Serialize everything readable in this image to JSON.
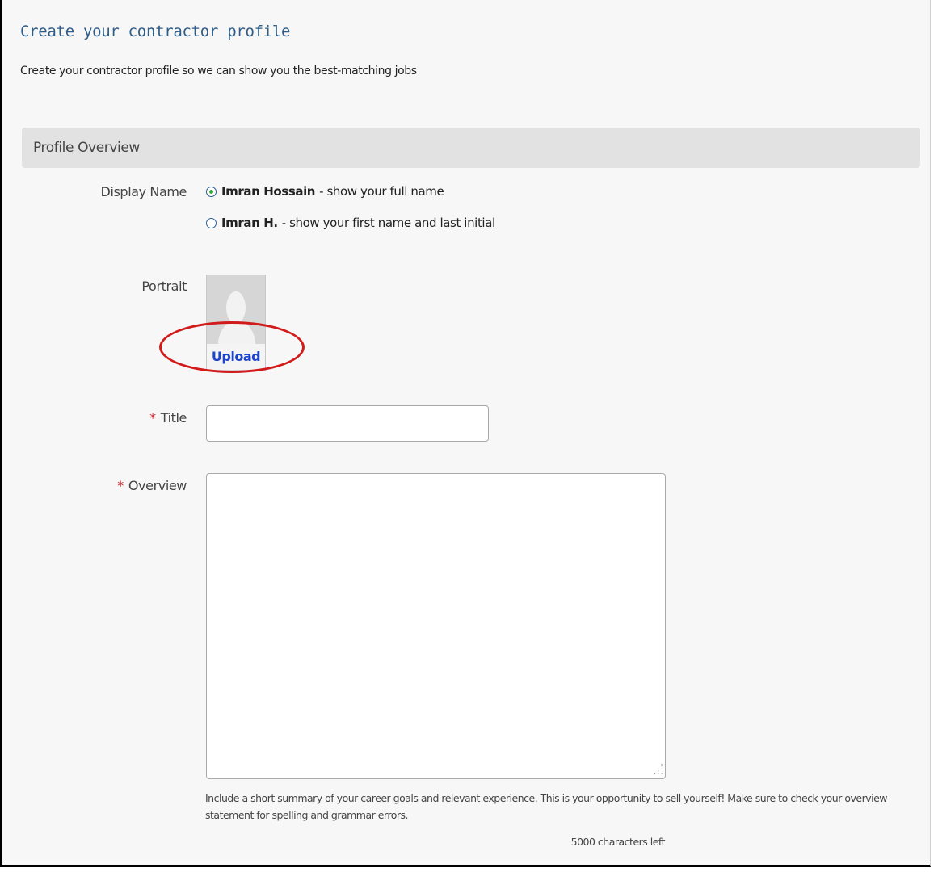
{
  "page": {
    "title": "Create your contractor profile",
    "subtitle": "Create your contractor profile so we can show you the best-matching jobs"
  },
  "section": {
    "header": "Profile Overview"
  },
  "display_name": {
    "label": "Display Name",
    "options": [
      {
        "name": "Imran Hossain",
        "description": "- show your full name",
        "selected": true
      },
      {
        "name": "Imran H.",
        "description": "- show your first name and last initial",
        "selected": false
      }
    ]
  },
  "portrait": {
    "label": "Portrait",
    "upload_label": "Upload",
    "placeholder_icon": "person-silhouette-icon"
  },
  "title_field": {
    "required_marker": "*",
    "label": "Title",
    "value": ""
  },
  "overview_field": {
    "required_marker": "*",
    "label": "Overview",
    "value": "",
    "help": "Include a short summary of your career goals and relevant experience. This is your opportunity to sell yourself! Make sure to check your overview statement for spelling and grammar errors.",
    "char_count": "5000 characters left"
  },
  "colors": {
    "title": "#2d5d88",
    "link": "#1d44c9",
    "required": "#d0242a",
    "highlight": "#d11b1b",
    "section_bg": "#e2e2e2"
  }
}
